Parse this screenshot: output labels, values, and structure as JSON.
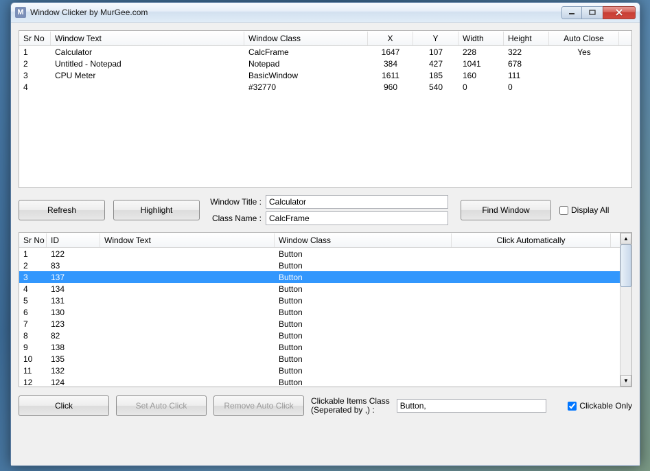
{
  "title": "Window Clicker by MurGee.com",
  "app_icon_letter": "M",
  "top_table": {
    "headers": [
      "Sr No",
      "Window Text",
      "Window Class",
      "X",
      "Y",
      "Width",
      "Height",
      "Auto Close"
    ],
    "rows": [
      {
        "sr": "1",
        "wt": "Calculator",
        "wc": "CalcFrame",
        "x": "1647",
        "y": "107",
        "w": "228",
        "h": "322",
        "ac": "Yes"
      },
      {
        "sr": "2",
        "wt": "Untitled - Notepad",
        "wc": "Notepad",
        "x": "384",
        "y": "427",
        "w": "1041",
        "h": "678",
        "ac": ""
      },
      {
        "sr": "3",
        "wt": "CPU Meter",
        "wc": "BasicWindow",
        "x": "1611",
        "y": "185",
        "w": "160",
        "h": "111",
        "ac": ""
      },
      {
        "sr": "4",
        "wt": "",
        "wc": "#32770",
        "x": "960",
        "y": "540",
        "w": "0",
        "h": "0",
        "ac": ""
      }
    ]
  },
  "mid": {
    "refresh": "Refresh",
    "highlight": "Highlight",
    "window_title_label": "Window Title :",
    "window_title_value": "Calculator",
    "class_name_label": "Class Name :",
    "class_name_value": "CalcFrame",
    "find_window": "Find Window",
    "display_all": "Display All"
  },
  "bottom_table": {
    "headers": [
      "Sr No",
      "ID",
      "Window Text",
      "Window Class",
      "Click Automatically"
    ],
    "selected_index": 2,
    "rows": [
      {
        "sr": "1",
        "id": "122",
        "wt": "",
        "wc": "Button",
        "ca": ""
      },
      {
        "sr": "2",
        "id": "83",
        "wt": "",
        "wc": "Button",
        "ca": ""
      },
      {
        "sr": "3",
        "id": "137",
        "wt": "",
        "wc": "Button",
        "ca": ""
      },
      {
        "sr": "4",
        "id": "134",
        "wt": "",
        "wc": "Button",
        "ca": ""
      },
      {
        "sr": "5",
        "id": "131",
        "wt": "",
        "wc": "Button",
        "ca": ""
      },
      {
        "sr": "6",
        "id": "130",
        "wt": "",
        "wc": "Button",
        "ca": ""
      },
      {
        "sr": "7",
        "id": "123",
        "wt": "",
        "wc": "Button",
        "ca": ""
      },
      {
        "sr": "8",
        "id": "82",
        "wt": "",
        "wc": "Button",
        "ca": ""
      },
      {
        "sr": "9",
        "id": "138",
        "wt": "",
        "wc": "Button",
        "ca": ""
      },
      {
        "sr": "10",
        "id": "135",
        "wt": "",
        "wc": "Button",
        "ca": ""
      },
      {
        "sr": "11",
        "id": "132",
        "wt": "",
        "wc": "Button",
        "ca": ""
      },
      {
        "sr": "12",
        "id": "124",
        "wt": "",
        "wc": "Button",
        "ca": ""
      }
    ]
  },
  "bottom": {
    "click": "Click",
    "set_auto_click": "Set Auto Click",
    "remove_auto_click": "Remove Auto Click",
    "clickable_items_label": "Clickable Items Class\n(Seperated by ,) :",
    "clickable_items_value": "Button,",
    "clickable_only": "Clickable Only",
    "clickable_only_checked": true
  }
}
